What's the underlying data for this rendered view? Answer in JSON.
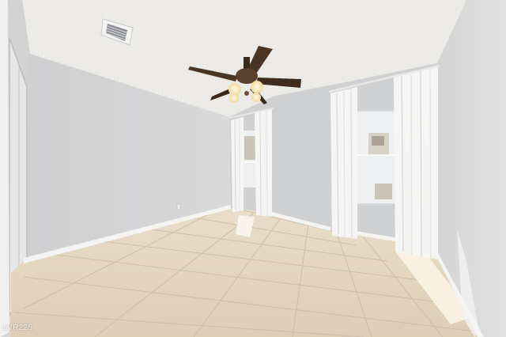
{
  "watermark": "LVR225",
  "colors": {
    "ceiling": "#ecebe8",
    "wall_left": "#d5d5d6",
    "wall_back": "#cfd0d1",
    "wall_right": "#dcdcdd",
    "floor": "#e5d7c2",
    "grout": "#cbbba3",
    "baseboard": "#f4f4f3",
    "curtain": "#f5f5f4",
    "curtain_shadow": "#dddddd",
    "window_glass": "#eef0f2",
    "fan_blade": "#4a3524",
    "fan_light": "#f6e3b0",
    "sunlight": "#fbf3e4"
  },
  "icons": [
    "ceiling-fan-icon",
    "air-vent-icon"
  ]
}
